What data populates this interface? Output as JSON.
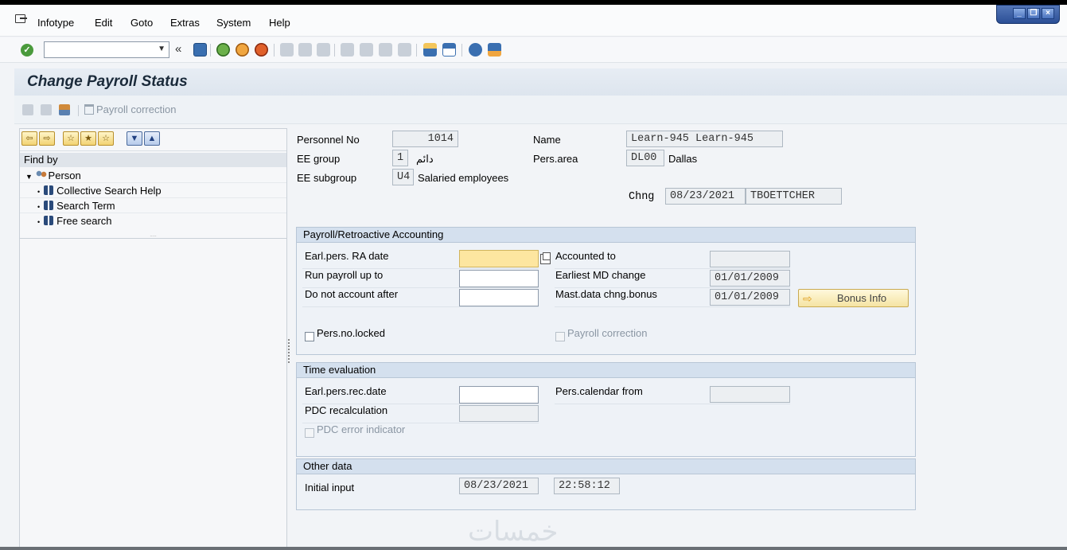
{
  "menu": {
    "items": [
      {
        "label": "Infotype"
      },
      {
        "label": "Edit"
      },
      {
        "label": "Goto"
      },
      {
        "label": "Extras"
      },
      {
        "label": "System"
      },
      {
        "label": "Help"
      }
    ]
  },
  "toolbar": {
    "command_field": "",
    "back_arrows": "«"
  },
  "title": "Change Payroll Status",
  "app_toolbar": {
    "payroll_correction": "Payroll correction"
  },
  "left_panel": {
    "find_by": "Find by",
    "person": "Person",
    "items": [
      "Collective Search Help",
      "Search Term",
      "Free search"
    ],
    "splitter": "....."
  },
  "header": {
    "personnel_no_label": "Personnel No",
    "personnel_no": "1014",
    "name_label": "Name",
    "name": "Learn-945 Learn-945",
    "ee_group_label": "EE group",
    "ee_group_code": "1",
    "ee_group_text": "دائم",
    "pers_area_label": "Pers.area",
    "pers_area_code": "DL00",
    "pers_area_text": "Dallas",
    "ee_subgroup_label": "EE subgroup",
    "ee_subgroup_code": "U4",
    "ee_subgroup_text": "Salaried employees",
    "chng_label": "Chng",
    "chng_date": "08/23/2021",
    "chng_user": "TBOETTCHER"
  },
  "payroll_group": {
    "title": "Payroll/Retroactive Accounting",
    "earl_ra_label": "Earl.pers. RA date",
    "earl_ra_value": "",
    "run_up_to_label": "Run payroll up to",
    "run_up_to_value": "",
    "not_after_label": "Do not account after",
    "not_after_value": "",
    "accounted_to_label": "Accounted to",
    "accounted_to_value": "",
    "earliest_md_label": "Earliest MD change",
    "earliest_md_value": "01/01/2009",
    "mast_bonus_label": "Mast.data chng.bonus",
    "mast_bonus_value": "01/01/2009",
    "bonus_button": "Bonus Info",
    "locked_label": "Pers.no.locked",
    "payroll_corr_label": "Payroll correction"
  },
  "time_group": {
    "title": "Time evaluation",
    "earl_rec_label": "Earl.pers.rec.date",
    "earl_rec_value": "",
    "pdc_recalc_label": "PDC recalculation",
    "pdc_recalc_value": "",
    "pdc_error_label": "PDC error indicator",
    "pers_cal_label": "Pers.calendar from",
    "pers_cal_value": ""
  },
  "other_group": {
    "title": "Other data",
    "initial_input_label": "Initial input",
    "initial_date": "08/23/2021",
    "initial_time": "22:58:12"
  },
  "watermark": "خمسات",
  "colors": {
    "title_bar": "#dde5ee",
    "group_header": "#d4e0ee",
    "required_field": "#fde6a0"
  }
}
